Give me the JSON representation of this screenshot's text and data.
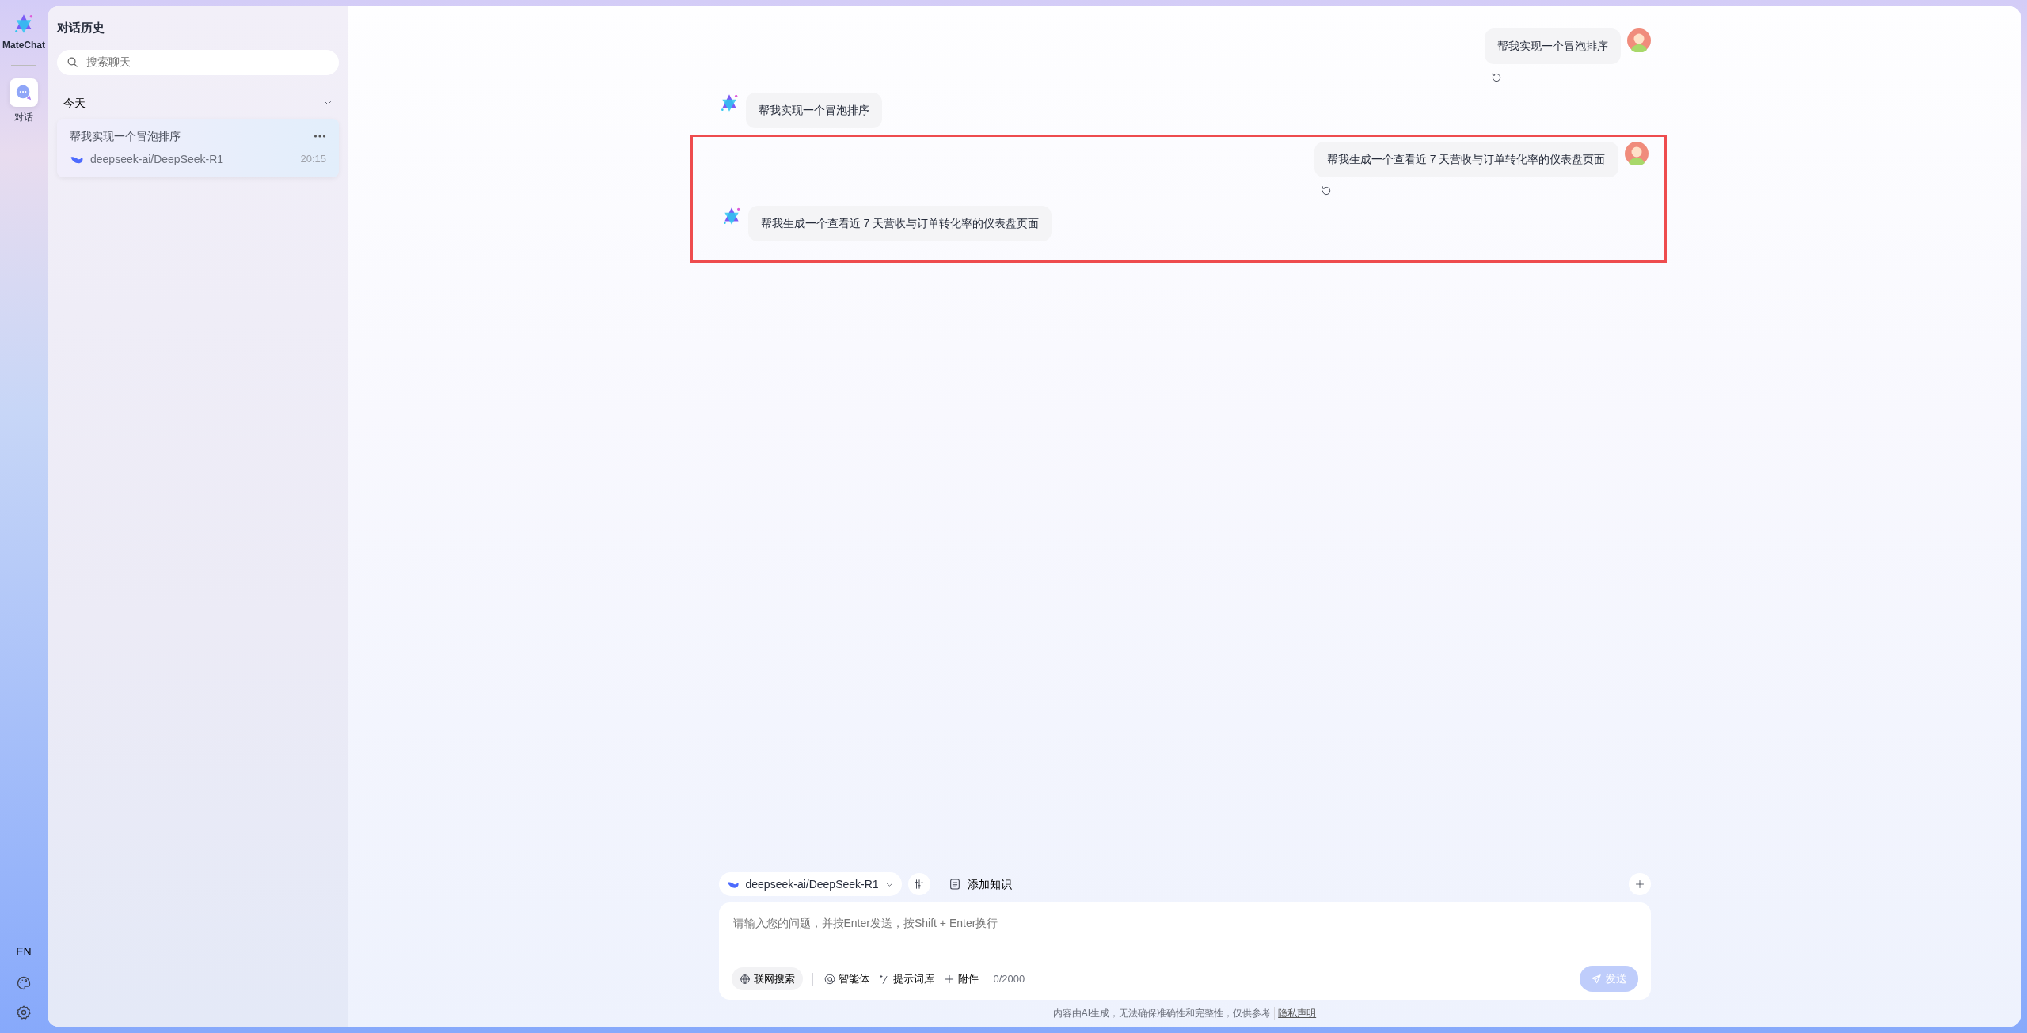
{
  "rail": {
    "logo_label": "MateChat",
    "items": [
      {
        "label": "对话",
        "selected": true
      }
    ],
    "language": "EN"
  },
  "sidebar": {
    "title": "对话历史",
    "search": {
      "placeholder": "搜索聊天"
    },
    "groups": [
      {
        "label": "今天",
        "expanded": true,
        "items": [
          {
            "title": "帮我实现一个冒泡排序",
            "model": "deepseek-ai/DeepSeek-R1",
            "time": "20:15",
            "selected": true
          }
        ]
      }
    ]
  },
  "messages": [
    {
      "kind": "user",
      "text": "帮我实现一个冒泡排序",
      "highlighted": false
    },
    {
      "kind": "assistant",
      "text": "帮我实现一个冒泡排序",
      "highlighted": false
    },
    {
      "kind": "user",
      "text": "帮我生成一个查看近 7 天营收与订单转化率的仪表盘页面",
      "highlighted": true
    },
    {
      "kind": "assistant",
      "text": "帮我生成一个查看近 7 天营收与订单转化率的仪表盘页面",
      "highlighted": true
    }
  ],
  "composer": {
    "model": "deepseek-ai/DeepSeek-R1",
    "knowledge_label": "添加知识",
    "placeholder": "请输入您的问题，并按Enter发送，按Shift + Enter换行",
    "tools": [
      {
        "kind": "chip",
        "label": "联网搜索"
      },
      {
        "kind": "at",
        "label": "智能体"
      },
      {
        "kind": "prompt",
        "label": "提示词库"
      },
      {
        "kind": "attach",
        "label": "附件"
      }
    ],
    "counter": "0/2000",
    "send": {
      "label": "发送",
      "disabled": true
    }
  },
  "footer": {
    "text": "内容由AI生成，无法确保准确性和完整性，仅供参考",
    "link": "隐私声明"
  }
}
